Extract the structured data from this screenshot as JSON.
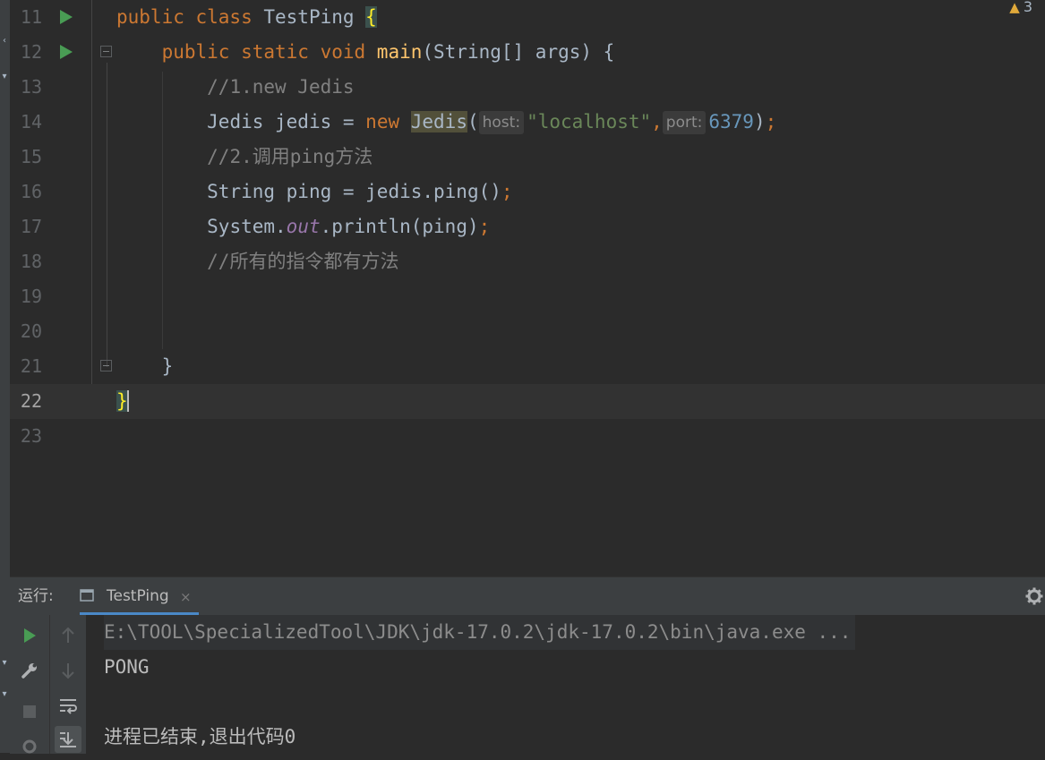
{
  "editor": {
    "warning_count": "3",
    "lines": [
      {
        "num": "11",
        "current": false,
        "run": true,
        "fold": false
      },
      {
        "num": "12",
        "current": false,
        "run": true,
        "fold": true
      },
      {
        "num": "13",
        "current": false,
        "run": false,
        "fold": false
      },
      {
        "num": "14",
        "current": false,
        "run": false,
        "fold": false
      },
      {
        "num": "15",
        "current": false,
        "run": false,
        "fold": false
      },
      {
        "num": "16",
        "current": false,
        "run": false,
        "fold": false
      },
      {
        "num": "17",
        "current": false,
        "run": false,
        "fold": false
      },
      {
        "num": "18",
        "current": false,
        "run": false,
        "fold": false
      },
      {
        "num": "19",
        "current": false,
        "run": false,
        "fold": false
      },
      {
        "num": "20",
        "current": false,
        "run": false,
        "fold": false
      },
      {
        "num": "21",
        "current": false,
        "run": false,
        "fold": true
      },
      {
        "num": "22",
        "current": true,
        "run": false,
        "fold": false
      },
      {
        "num": "23",
        "current": false,
        "run": false,
        "fold": false
      }
    ],
    "code": {
      "l11_kw": "public class ",
      "l11_name": "TestPing ",
      "l11_brace": "{",
      "l12_kw": "public static void ",
      "l12_fn": "main",
      "l12_rest": "(String[] args) {",
      "l13_comment": "//1.new Jedis",
      "l14_decl": "Jedis jedis = ",
      "l14_new": "new ",
      "l14_class": "Jedis",
      "l14_open": "(",
      "l14_hint_host": "host:",
      "l14_str": "\"localhost\"",
      "l14_comma": ",",
      "l14_hint_port": "port:",
      "l14_num": "6379",
      "l14_close": ")",
      "l14_semi": ";",
      "l15_comment": "//2.调用ping方法",
      "l16_code": "String ping = jedis.ping()",
      "l16_semi": ";",
      "l17_a": "System.",
      "l17_field": "out",
      "l17_b": ".println(ping)",
      "l17_semi": ";",
      "l18_comment": "//所有的指令都有方法",
      "l21_brace": "}",
      "l22_brace": "}"
    }
  },
  "run_window": {
    "label": "运行:",
    "tab_label": "TestPing",
    "tab_close": "×",
    "console": {
      "command": "E:\\TOOL\\SpecializedTool\\JDK\\jdk-17.0.2\\jdk-17.0.2\\bin\\java.exe ...",
      "output": "PONG",
      "exit": "进程已结束,退出代码0"
    }
  },
  "colors": {
    "background": "#2b2b2b",
    "keyword": "#cc7832",
    "function": "#ffc66d",
    "comment": "#808080",
    "string": "#6a8759",
    "number": "#6897bb",
    "run_green": "#499c54"
  }
}
